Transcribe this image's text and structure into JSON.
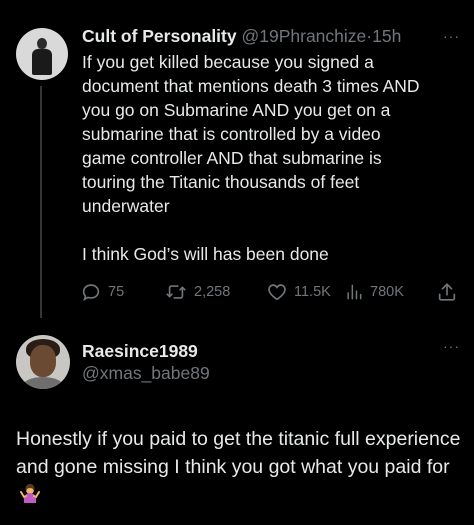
{
  "tweet1": {
    "display_name": "Cult of Personality",
    "handle": "@19Phranchize",
    "separator": "·",
    "time": "15h",
    "more": "···",
    "text": "If you get killed because you signed a\ndocument that mentions death 3 times AND\nyou go on Submarine AND you get on a\nsubmarine that is controlled by a video\ngame controller AND that submarine is\ntouring the Titanic thousands of feet\nunderwater\n\nI think God’s will has been done",
    "replies": "75",
    "retweets": "2,258",
    "likes": "11.5K",
    "views": "780K"
  },
  "tweet2": {
    "display_name": "Raesince1989",
    "handle": "@xmas_babe89",
    "more": "···",
    "text": "Honestly if you paid to get the titanic full experience and gone missing I think you got what you paid for",
    "emoji": "woman-shrugging-emoji"
  },
  "colors": {
    "background": "#000000",
    "text": "#e7e9ea",
    "muted": "#71767b",
    "thread_line": "#333639"
  }
}
